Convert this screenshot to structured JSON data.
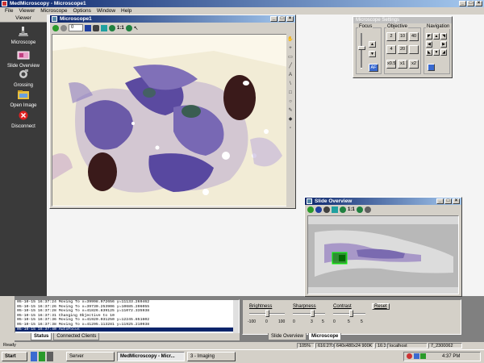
{
  "app": {
    "title": "MedMicroscopy - Microscope1",
    "menu": [
      "File",
      "Viewer",
      "Microscope",
      "Options",
      "Window",
      "Help"
    ]
  },
  "sidebar": {
    "header": "Viewer",
    "items": [
      {
        "label": "Microscope",
        "icon": "microscope-icon"
      },
      {
        "label": "Slide Overview",
        "icon": "slide-icon"
      },
      {
        "label": "Grossing",
        "icon": "camera-icon"
      },
      {
        "label": "Open Image",
        "icon": "folder-icon"
      },
      {
        "label": "Disconnect",
        "icon": "disconnect-icon"
      }
    ]
  },
  "microscope_window": {
    "title": "Microscope1",
    "zoom_value": "0",
    "zoom_ratio": "1:1"
  },
  "settings": {
    "title": "Microscope Settings",
    "focus_label": "Focus",
    "objective_label": "Objective",
    "navigation_label": "Navigation",
    "af_label": "AF",
    "objectives": [
      "2",
      "10",
      "40",
      "4",
      "20",
      "",
      "x0.5",
      "x1",
      "x2"
    ]
  },
  "overview": {
    "title": "Slide Overview",
    "zoom_ratio": "1:1"
  },
  "log": {
    "lines": [
      "05-10-15 16:37:24 Moving To x=39998.972656 y=11133.269462",
      "05-10-15 16:37:26 Moving To x=39730.253906 y=10685.206055",
      "05-10-15 16:37:28 Moving To x=41826.839125 y=11072.335938",
      "05-10-15 16:37:31 Changing Objective to 10",
      "05-10-15 16:37:36 Moving To x=41920.031250 y=12245.851602",
      "05-10-15 16:37:38 Moving To x=41295.113281 y=11925.210938",
      "05-10-15 16:37:40 AutoFocus"
    ],
    "selected_index": 6,
    "tabs": [
      "Status",
      "Connected Clients"
    ]
  },
  "controls": {
    "brightness": {
      "label": "Brightness",
      "min": "-100",
      "mid": "0",
      "max": "100"
    },
    "sharpness": {
      "label": "Sharpness",
      "min": "0",
      "mid": "3",
      "max": "5"
    },
    "contrast": {
      "label": "Contrast",
      "min": "0",
      "mid": "5",
      "max": "5"
    },
    "reset_label": "Reset",
    "tabs": [
      "Slide Overview",
      "Microscope"
    ],
    "active_tab": "Microscope"
  },
  "status_bar": {
    "text": "Ready",
    "zoom": "105%",
    "coords": "616:270",
    "resolution": "640x480x24 900K",
    "time": "16:37",
    "host": "localhost",
    "id": "7_2300062"
  },
  "taskbar": {
    "start": "Start",
    "tasks": [
      "Server",
      "MedMicroscopy - Micr...",
      "3 - Imaging"
    ],
    "clock": "4:37 PM"
  },
  "colors": {
    "titlebar": "#0a246a",
    "stain_purple": "#5b4aa0",
    "stain_dark": "#3a1a1a",
    "overview_box": "#1a8a1a"
  }
}
